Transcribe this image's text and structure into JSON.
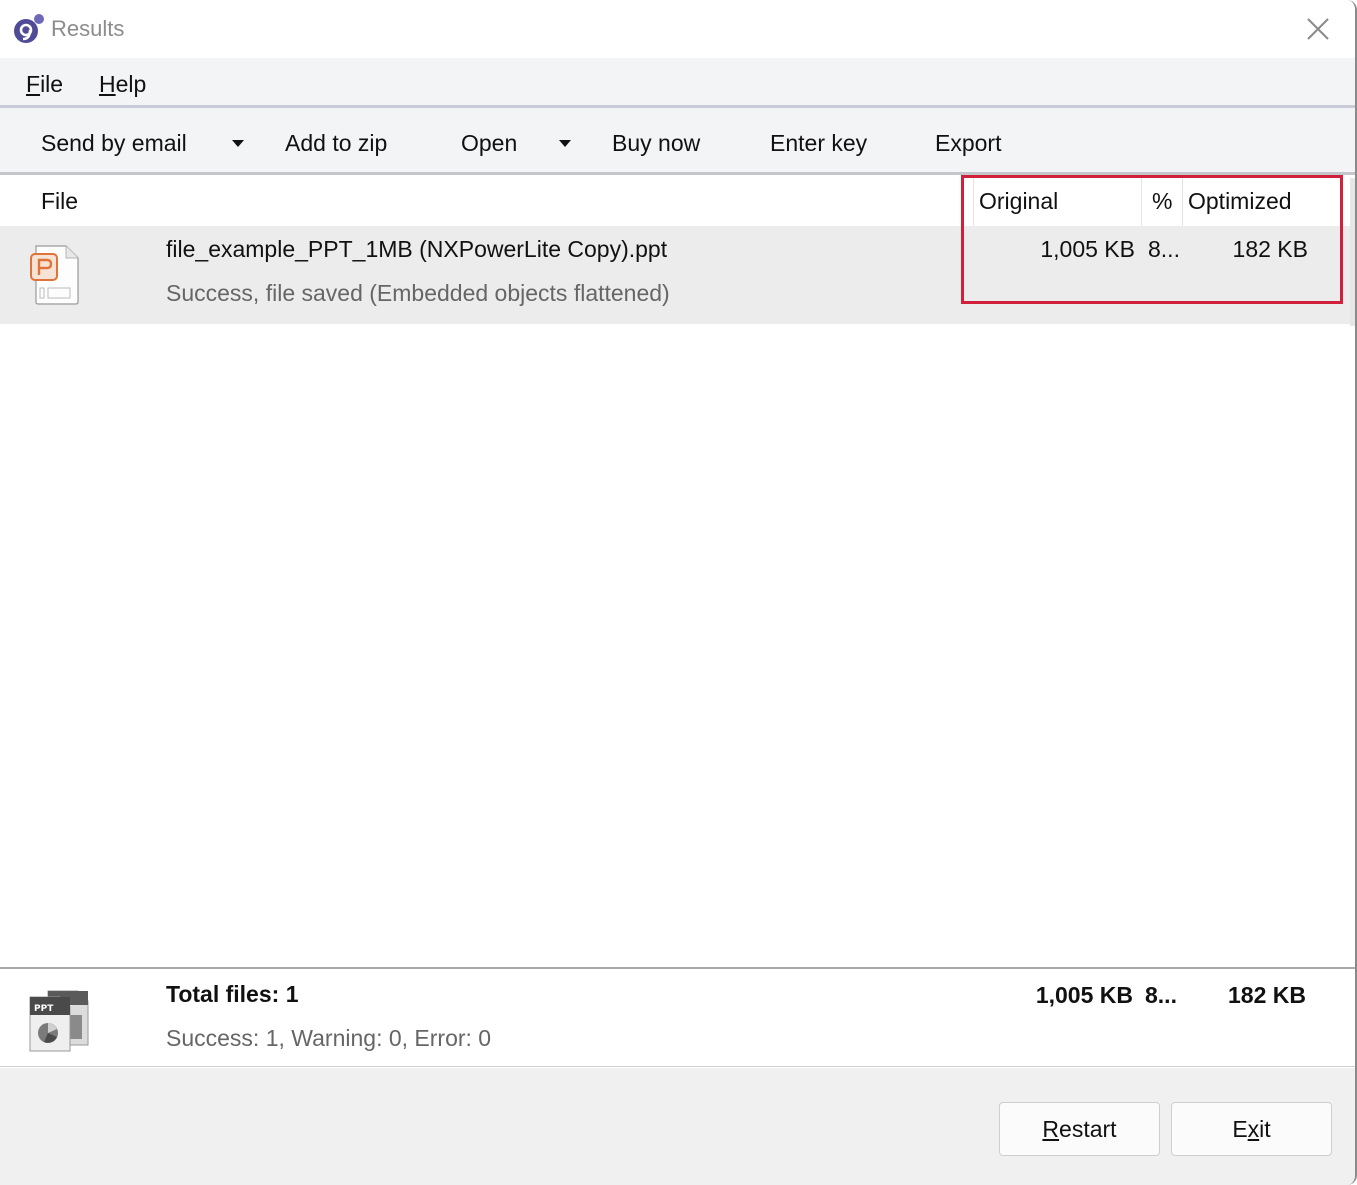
{
  "window": {
    "title": "Results",
    "app_icon": "app-logo-icon",
    "close_icon": "close-icon"
  },
  "menu": {
    "items": [
      {
        "label_accel": "F",
        "label_rest": "ile"
      },
      {
        "label_accel": "H",
        "label_rest": "elp"
      }
    ]
  },
  "toolbar": {
    "send_by_email": "Send by email",
    "add_to_zip": "Add to zip",
    "open": "Open",
    "buy_now": "Buy now",
    "enter_key": "Enter key",
    "export": "Export",
    "dropdown_icon": "caret-down-icon"
  },
  "list": {
    "columns": {
      "file": "File",
      "original": "Original",
      "percent": "%",
      "optimized": "Optimized"
    },
    "rows": [
      {
        "icon": "powerpoint-file-icon",
        "name": "file_example_PPT_1MB (NXPowerLite Copy).ppt",
        "status": "Success, file saved (Embedded objects flattened)",
        "original": "1,005 KB",
        "percent": "8...",
        "optimized": "182 KB"
      }
    ]
  },
  "summary": {
    "icon": "ppt-files-stack-icon",
    "title": "Total files: 1",
    "status": "Success: 1, Warning: 0, Error: 0",
    "original": "1,005 KB",
    "percent": "8...",
    "optimized": "182 KB"
  },
  "footer": {
    "restart_accel": "R",
    "restart_rest": "estart",
    "exit_pre": "E",
    "exit_accel": "x",
    "exit_rest": "it"
  },
  "colors": {
    "highlight": "#d0203a",
    "ppt_orange": "#e0733a"
  }
}
